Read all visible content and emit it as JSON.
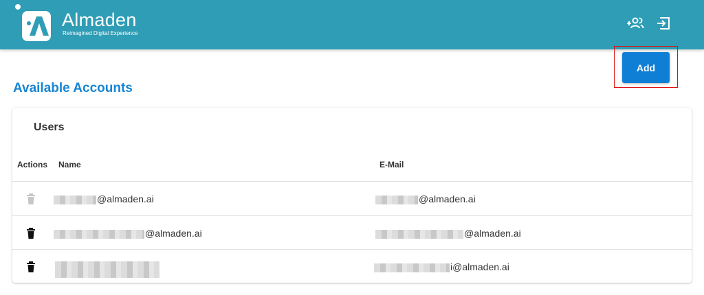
{
  "header": {
    "app_name": "Almaden",
    "tagline": "Reimagined Digital Experience",
    "bg_color": "#2e9db5",
    "icons": [
      "add-user-icon",
      "logout-icon"
    ]
  },
  "actions": {
    "add_label": "Add",
    "accent": "#0f7fd6"
  },
  "page": {
    "title": "Available Accounts"
  },
  "users_table": {
    "title": "Users",
    "columns": {
      "actions": "Actions",
      "name": "Name",
      "email": "E-Mail"
    },
    "rows": [
      {
        "name_domain": "@almaden.ai",
        "email_domain": "@almaden.ai",
        "delete_enabled": false
      },
      {
        "name_domain": "@almaden.ai",
        "email_domain": "@almaden.ai",
        "delete_enabled": true
      },
      {
        "name_domain": "",
        "email_domain": "i@almaden.ai",
        "delete_enabled": true
      }
    ]
  }
}
